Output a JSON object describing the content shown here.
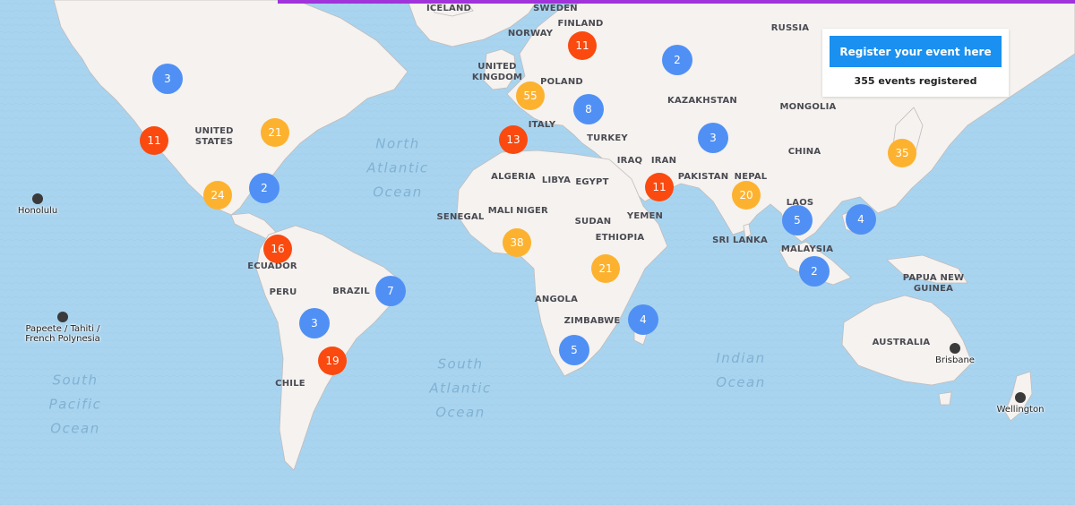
{
  "colors": {
    "ocean": "#a9d4ef",
    "land": "#f5f2ef",
    "border": "#bfbcbc",
    "accent_bar": "#a033d9",
    "button": "#1a90f0",
    "cluster_small": "#5090f5",
    "cluster_medium": "#fdb22f",
    "cluster_large": "#fa4a10"
  },
  "panel": {
    "register_label": "Register your event here",
    "events_registered": "355 events registered"
  },
  "country_labels": [
    "ICELAND",
    "SWEDEN",
    "FINLAND",
    "NORWAY",
    "RUSSIA",
    "UNITED\nKINGDOM",
    "POLAND",
    "KAZAKHSTAN",
    "MONGOLIA",
    "UNITED\nSTATES",
    "ITALY",
    "TURKEY",
    "CHINA",
    "IRAQ",
    "IRAN",
    "ALGERIA",
    "LIBYA",
    "EGYPT",
    "PAKISTAN",
    "NEPAL",
    "SENEGAL",
    "MALI",
    "NIGER",
    "SUDAN",
    "YEMEN",
    "LAOS",
    "ETHIOPIA",
    "SRI LANKA",
    "MALAYSIA",
    "ECUADOR",
    "PERU",
    "BRAZIL",
    "PAPUA NEW\nGUINEA",
    "ANGOLA",
    "ZIMBABWE",
    "AUSTRALIA",
    "CHILE"
  ],
  "ocean_labels": [
    "North\nAtlantic\nOcean",
    "South\nAtlantic\nOcean",
    "Indian\nOcean",
    "South\nPacific\nOcean"
  ],
  "cities": [
    "Honolulu",
    "Papeete / Tahiti /\nFrench Polynesia",
    "Brisbane",
    "Wellington"
  ],
  "clusters": [
    {
      "count": "3",
      "level": "small"
    },
    {
      "count": "11",
      "level": "large"
    },
    {
      "count": "21",
      "level": "medium"
    },
    {
      "count": "24",
      "level": "medium"
    },
    {
      "count": "2",
      "level": "small"
    },
    {
      "count": "16",
      "level": "large"
    },
    {
      "count": "7",
      "level": "small"
    },
    {
      "count": "3",
      "level": "small"
    },
    {
      "count": "19",
      "level": "large"
    },
    {
      "count": "11",
      "level": "large"
    },
    {
      "count": "55",
      "level": "medium"
    },
    {
      "count": "8",
      "level": "small"
    },
    {
      "count": "13",
      "level": "large"
    },
    {
      "count": "2",
      "level": "small"
    },
    {
      "count": "3",
      "level": "small"
    },
    {
      "count": "11",
      "level": "large"
    },
    {
      "count": "38",
      "level": "medium"
    },
    {
      "count": "21",
      "level": "medium"
    },
    {
      "count": "4",
      "level": "small"
    },
    {
      "count": "5",
      "level": "small"
    },
    {
      "count": "20",
      "level": "medium"
    },
    {
      "count": "5",
      "level": "small"
    },
    {
      "count": "4",
      "level": "small"
    },
    {
      "count": "2",
      "level": "small"
    },
    {
      "count": "35",
      "level": "medium"
    }
  ]
}
